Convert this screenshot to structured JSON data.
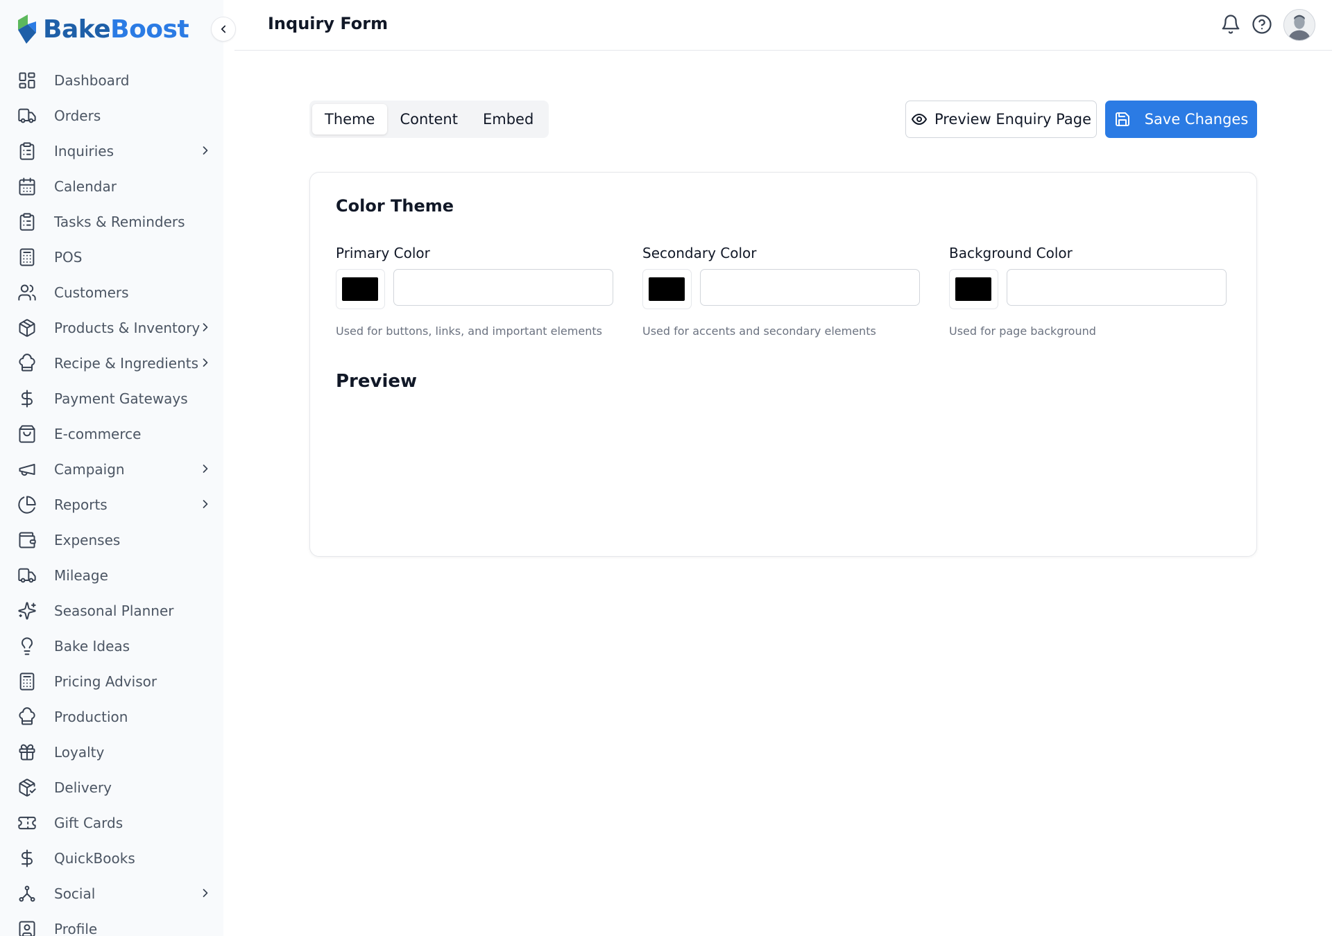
{
  "brand": {
    "name_part1": "Bake",
    "name_part2": "Boost",
    "colors": {
      "primary": "#2b7be4",
      "dark": "#1e5fa8",
      "green": "#5cb85c"
    }
  },
  "sidebar": {
    "collapse_icon": "chevron-left-icon",
    "items": [
      {
        "label": "Dashboard",
        "icon": "dashboard-icon",
        "has_submenu": false
      },
      {
        "label": "Orders",
        "icon": "truck-icon",
        "has_submenu": false
      },
      {
        "label": "Inquiries",
        "icon": "clipboard-icon",
        "has_submenu": true
      },
      {
        "label": "Calendar",
        "icon": "calendar-icon",
        "has_submenu": false
      },
      {
        "label": "Tasks & Reminders",
        "icon": "clipboard-list-icon",
        "has_submenu": false
      },
      {
        "label": "POS",
        "icon": "calculator-icon",
        "has_submenu": false
      },
      {
        "label": "Customers",
        "icon": "users-icon",
        "has_submenu": false
      },
      {
        "label": "Products & Inventory",
        "icon": "package-icon",
        "has_submenu": true
      },
      {
        "label": "Recipe & Ingredients",
        "icon": "chef-hat-icon",
        "has_submenu": true
      },
      {
        "label": "Payment Gateways",
        "icon": "dollar-icon",
        "has_submenu": false
      },
      {
        "label": "E-commerce",
        "icon": "shopping-bag-icon",
        "has_submenu": false
      },
      {
        "label": "Campaign",
        "icon": "megaphone-icon",
        "has_submenu": true
      },
      {
        "label": "Reports",
        "icon": "pie-chart-icon",
        "has_submenu": true
      },
      {
        "label": "Expenses",
        "icon": "wallet-icon",
        "has_submenu": false
      },
      {
        "label": "Mileage",
        "icon": "truck-icon",
        "has_submenu": false
      },
      {
        "label": "Seasonal Planner",
        "icon": "sparkles-icon",
        "has_submenu": false
      },
      {
        "label": "Bake Ideas",
        "icon": "lightbulb-icon",
        "has_submenu": false
      },
      {
        "label": "Pricing Advisor",
        "icon": "calculator-icon",
        "has_submenu": false
      },
      {
        "label": "Production",
        "icon": "chef-hat-icon",
        "has_submenu": false
      },
      {
        "label": "Loyalty",
        "icon": "gift-icon",
        "has_submenu": false
      },
      {
        "label": "Delivery",
        "icon": "package-check-icon",
        "has_submenu": false
      },
      {
        "label": "Gift Cards",
        "icon": "ticket-icon",
        "has_submenu": false
      },
      {
        "label": "QuickBooks",
        "icon": "dollar-icon",
        "has_submenu": false
      },
      {
        "label": "Social",
        "icon": "network-icon",
        "has_submenu": true
      },
      {
        "label": "Profile",
        "icon": "user-square-icon",
        "has_submenu": false
      }
    ]
  },
  "header": {
    "title": "Inquiry Form",
    "icons": [
      "bell-icon",
      "help-circle-icon",
      "avatar"
    ]
  },
  "toolbar": {
    "tabs": [
      {
        "label": "Theme",
        "active": true
      },
      {
        "label": "Content",
        "active": false
      },
      {
        "label": "Embed",
        "active": false
      }
    ],
    "preview_label": "Preview Enquiry Page",
    "save_label": "Save Changes"
  },
  "card": {
    "title": "Color Theme",
    "colors": [
      {
        "label": "Primary Color",
        "swatch": "#000000",
        "value": "",
        "help": "Used for buttons, links, and important elements"
      },
      {
        "label": "Secondary Color",
        "swatch": "#000000",
        "value": "",
        "help": "Used for accents and secondary elements"
      },
      {
        "label": "Background Color",
        "swatch": "#000000",
        "value": "",
        "help": "Used for page background"
      }
    ],
    "preview_title": "Preview"
  }
}
